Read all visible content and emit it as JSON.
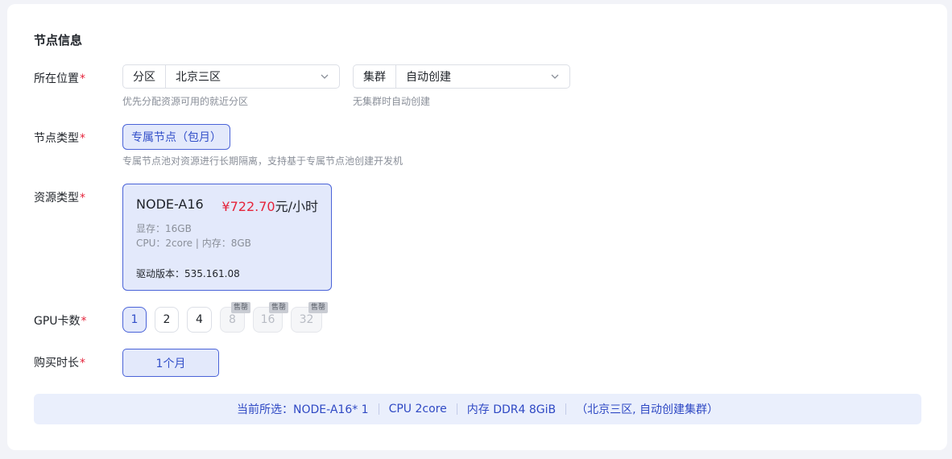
{
  "section_title": "节点信息",
  "location": {
    "label": "所在位置",
    "required_mark": "*",
    "zone": {
      "prefix": "分区",
      "value": "北京三区",
      "hint": "优先分配资源可用的就近分区"
    },
    "cluster": {
      "prefix": "集群",
      "value": "自动创建",
      "hint": "无集群时自动创建"
    }
  },
  "node_type": {
    "label": "节点类型",
    "required_mark": "*",
    "option": "专属节点（包月）",
    "hint": "专属节点池对资源进行长期隔离，支持基于专属节点池创建开发机"
  },
  "resource_type": {
    "label": "资源类型",
    "required_mark": "*",
    "card": {
      "name": "NODE-A16",
      "price": "¥722.70",
      "price_unit": "元/小时",
      "vram": "显存：16GB",
      "cpu_mem": "CPU：2core | 内存：8GB",
      "driver": "驱动版本：535.161.08"
    }
  },
  "gpu_count": {
    "label": "GPU卡数",
    "required_mark": "*",
    "sold_out_label": "售罄",
    "options": [
      {
        "value": "1",
        "state": "selected"
      },
      {
        "value": "2",
        "state": "normal"
      },
      {
        "value": "4",
        "state": "normal"
      },
      {
        "value": "8",
        "state": "sold_out"
      },
      {
        "value": "16",
        "state": "sold_out"
      },
      {
        "value": "32",
        "state": "sold_out"
      }
    ]
  },
  "duration": {
    "label": "购买时长",
    "required_mark": "*",
    "option": "1个月"
  },
  "summary": {
    "selected": "当前所选：NODE-A16* 1",
    "cpu": "CPU 2core",
    "memory": "内存 DDR4 8GiB",
    "location": "（北京三区, 自动创建集群）"
  },
  "colors": {
    "accent": "#4a63d8",
    "selected_bg": "#e3e9fb",
    "price": "#e5243b",
    "required": "#e5243b"
  }
}
